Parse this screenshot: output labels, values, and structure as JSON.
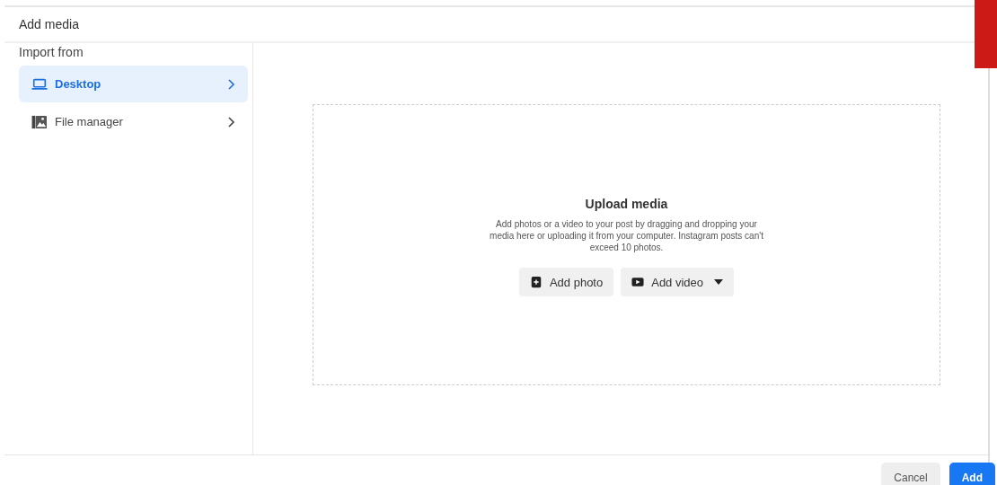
{
  "dialog": {
    "title": "Add media"
  },
  "sidebar": {
    "heading": "Import from",
    "items": [
      {
        "label": "Desktop",
        "kind": "laptop",
        "selected": true
      },
      {
        "label": "File manager",
        "kind": "image",
        "selected": false
      }
    ]
  },
  "upload": {
    "title": "Upload media",
    "description": "Add photos or a video to your post by dragging and dropping your media here or uploading it from your computer. Instagram posts can't exceed 10 photos.",
    "buttons": [
      {
        "label": "Add photo",
        "kind": "photo"
      },
      {
        "label": "Add video",
        "kind": "video"
      }
    ]
  },
  "footer": {
    "buttons": [
      {
        "label": "Cancel",
        "kind": "secondary"
      },
      {
        "label": "Add",
        "kind": "primary"
      }
    ]
  }
}
